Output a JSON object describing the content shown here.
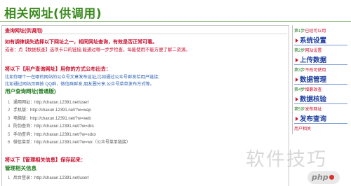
{
  "page": {
    "title": "相关网址(供调用)"
  },
  "main": {
    "section_title": "查询网址(供调用)",
    "notice_line1": "如有调律误失选择以下网址之一，相同网址查询，有效是否正常可看。",
    "notice_line2": "或者：点【数据核查】选项卡口的链接,能通过哪一步步检查，每能使用不能方便了解二资源。",
    "query_head": "将以下【用户查询网址】用你的方式公布出去：",
    "query_desc1": "比如你哪个一在哪的网站的公众号文章发布这址,比如通过公众号群发给用户链接;",
    "query_desc2": "比如通过网站页面按 QQ群，微信群群发,朋友圈分享,公众号菜单发布方式等。",
    "query_list_title": "用户查询网址(普通版)",
    "query_urls": [
      {
        "num": "1",
        "label": "通用网址：",
        "url": "http://chaxun.12391.net/user/"
      },
      {
        "num": "2",
        "label": "手机版：",
        "url": "http://chaxun.12391.net/?w=wap"
      },
      {
        "num": "3",
        "label": "电脑版：",
        "url": "http://chaxun.12391.net/?w=web"
      },
      {
        "num": "4",
        "label": "防伪查询：",
        "url": "http://chaxun.12391.net/?w=dcs"
      },
      {
        "num": "5",
        "label": "手动查询：",
        "url": "http://chaxun.12391.net/?w=sdcx"
      },
      {
        "num": "6",
        "label": "微信菜单：",
        "url": "http://chaxun.12391.net/?w=wx（公众号菜单链接）"
      }
    ],
    "admin_head": "将以下【管理相关信息】保存起来：",
    "admin_list_title": "管理相关信息",
    "admin_urls": [
      {
        "num": "1",
        "label": "后台登录：",
        "url": "http://chaxun.12391.net/user/"
      }
    ]
  },
  "sidebar": {
    "items": [
      {
        "step": "第1步",
        "hint": "已经可以用",
        "button": "系统设置"
      },
      {
        "step": "第2步",
        "hint": "网站设置",
        "button": "上传数据"
      },
      {
        "step": "第3步",
        "hint": "不改可使用",
        "button": "数据管理"
      },
      {
        "step": "第4步",
        "hint": "增删改查",
        "button": "数据核验"
      },
      {
        "step": "第5步",
        "hint": "发布网址",
        "button": "发布查询"
      }
    ],
    "footer": "用户相关"
  },
  "watermark": {
    "text": "软件技巧",
    "badge": "php"
  }
}
